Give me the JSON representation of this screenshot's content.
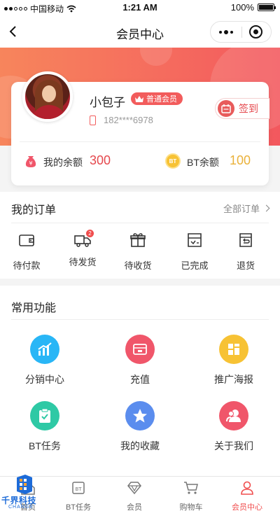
{
  "status_bar": {
    "carrier": "中国移动",
    "time": "1:21 AM",
    "battery": "100%",
    "battery_level": 1.0
  },
  "nav": {
    "title": "会员中心"
  },
  "profile": {
    "name": "小包子",
    "member_level": "普通会员",
    "phone": "182****6978",
    "checkin_label": "签到",
    "balance_label": "我的余额",
    "balance_value": "300",
    "bt_label": "BT余额",
    "bt_value": "100",
    "bt_coin_text": "BT"
  },
  "orders": {
    "title": "我的订单",
    "all_label": "全部订单",
    "items": [
      {
        "label": "待付款",
        "icon": "wallet-icon"
      },
      {
        "label": "待发货",
        "icon": "truck-icon",
        "badge": "2"
      },
      {
        "label": "待收货",
        "icon": "gift-icon"
      },
      {
        "label": "已完成",
        "icon": "box-check-icon"
      },
      {
        "label": "退货",
        "icon": "return-icon"
      }
    ]
  },
  "functions": {
    "title": "常用功能",
    "items": [
      {
        "label": "分销中心",
        "icon": "chart-icon",
        "color": "#29b6f6"
      },
      {
        "label": "充值",
        "icon": "recharge-icon",
        "color": "#f0566a"
      },
      {
        "label": "推广海报",
        "icon": "poster-icon",
        "color": "#f7c234"
      },
      {
        "label": "BT任务",
        "icon": "clipboard-check-icon",
        "color": "#2ec9a5"
      },
      {
        "label": "我的收藏",
        "icon": "star-icon",
        "color": "#5b8dee"
      },
      {
        "label": "关于我们",
        "icon": "users-icon",
        "color": "#f0566a"
      }
    ]
  },
  "tab_bar": {
    "items": [
      {
        "label": "首页",
        "icon": "home-icon"
      },
      {
        "label": "BT任务",
        "icon": "bt-task-icon"
      },
      {
        "label": "会员",
        "icon": "diamond-icon"
      },
      {
        "label": "购物车",
        "icon": "cart-icon"
      },
      {
        "label": "会员中心",
        "icon": "person-icon",
        "active": true
      }
    ]
  },
  "watermark": {
    "title": "千界科技",
    "subtitle": "CHANGE"
  },
  "colors": {
    "accent": "#f04d4d",
    "gold": "#eab13a",
    "hero_start": "#f7855c",
    "hero_end": "#f3585e"
  }
}
